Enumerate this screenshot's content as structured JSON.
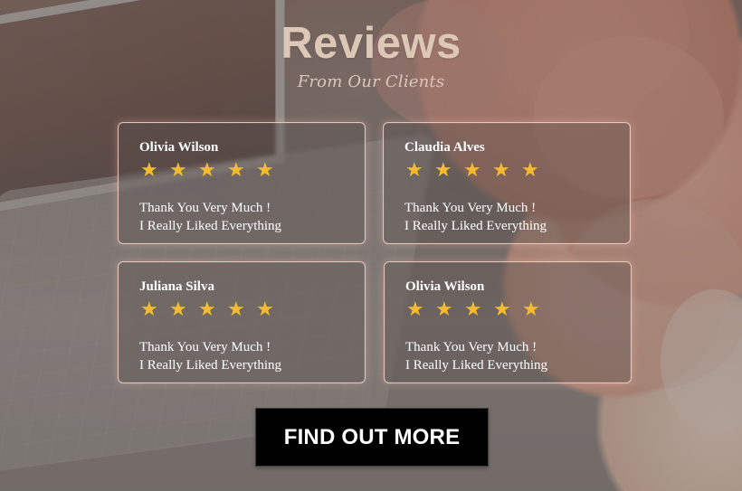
{
  "header": {
    "title": "Reviews",
    "subtitle": "From Our Clients"
  },
  "reviews": [
    {
      "name": "Olivia Wilson",
      "rating": 5,
      "line1": "Thank You Very Much !",
      "line2": "I Really Liked Everything"
    },
    {
      "name": "Claudia Alves",
      "rating": 5,
      "line1": "Thank You Very Much !",
      "line2": "I Really Liked Everything"
    },
    {
      "name": "Juliana Silva",
      "rating": 5,
      "line1": "Thank You Very Much !",
      "line2": "I Really Liked Everything"
    },
    {
      "name": "Olivia Wilson",
      "rating": 5,
      "line1": "Thank You Very Much !",
      "line2": "I Really Liked Everything"
    }
  ],
  "cta": {
    "label": "FIND OUT MORE"
  },
  "icons": {
    "star": "star-icon"
  },
  "colors": {
    "title": "#ddc8b8",
    "star": "#f7bc2e",
    "button_bg": "#000000",
    "button_text": "#ffffff",
    "card_border": "#ffd6c9"
  }
}
